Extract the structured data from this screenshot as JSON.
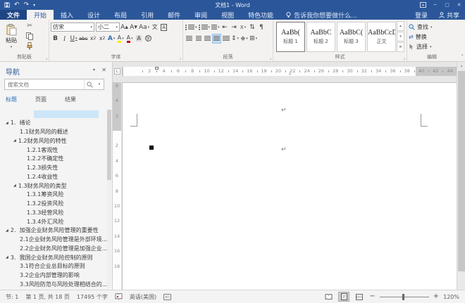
{
  "title_bar": {
    "title": "文档1 - Word",
    "signin_label": "登录",
    "share_label": "共享"
  },
  "glyphs": {
    "undo": "↶",
    "redo": "↷",
    "qat_more": "▾",
    "minimize": "─",
    "maximize": "▢",
    "close": "✕",
    "dropdown": "▾",
    "dropup": "▴",
    "more": "≣",
    "nav_close": "✕",
    "scissors": "✂",
    "grow_font": "A▴",
    "shrink_font": "A▾",
    "change_case": "Aa",
    "phonetic": "文",
    "char_border": "A",
    "bold": "B",
    "italic": "I",
    "underline": "U",
    "strikethrough": "abc",
    "subscript_base": "x",
    "subscript_mark": "2",
    "superscript_mark": "2",
    "text_effects": "A",
    "highlight": "A",
    "font_color": "A",
    "char_shading": "A",
    "enclose_char": "字",
    "outdent": "⇤",
    "indent": "⇥",
    "cjk_layout": "X",
    "sort": "⇅",
    "para_marks": "¶",
    "line_spacing": "⇕",
    "shading": "◆",
    "borders": "⊞",
    "replace_icon": "⇄",
    "expand_arrow": "◢",
    "launcher": "⌟",
    "ribbon_collapse": "˄",
    "angle": "∟",
    "center_tab": "⊥",
    "return_mark": "↵",
    "scroll_up": "▲",
    "zoom_minus": "−",
    "zoom_plus": "+"
  },
  "tabs": {
    "file": "文件",
    "items": [
      "开始",
      "插入",
      "设计",
      "布局",
      "引用",
      "邮件",
      "审阅",
      "视图",
      "特色功能"
    ],
    "selected": "开始",
    "tell_me": "告诉我你想要做什么..."
  },
  "ribbon": {
    "clipboard": {
      "label": "剪贴板",
      "paste": "粘贴"
    },
    "font": {
      "label": "字体",
      "font_name": "仿宋",
      "font_size": "小二"
    },
    "paragraph": {
      "label": "段落"
    },
    "styles": {
      "label": "样式",
      "items": [
        {
          "preview": "AaBb(",
          "name": "标题 1",
          "selected": true
        },
        {
          "preview": "AaBbC",
          "name": "标题 2",
          "selected": false
        },
        {
          "preview": "AaBbC(",
          "name": "标题 3",
          "selected": false
        },
        {
          "preview": "AaBbCcDd",
          "name": "正文",
          "selected": false
        }
      ]
    },
    "editing": {
      "label": "编辑",
      "find": "查找",
      "replace": "替换",
      "select": "选择"
    }
  },
  "nav_pane": {
    "title": "导航",
    "search_placeholder": "搜索文档",
    "tabs": [
      "标题",
      "页面",
      "结果"
    ],
    "selected_tab": "标题",
    "items": [
      {
        "blank": true,
        "selected": true,
        "level": 4,
        "text": ""
      },
      {
        "level": 1,
        "arrow": true,
        "text": "1.  绪论"
      },
      {
        "level": 2,
        "arrow": false,
        "text": "1.1财务风险的概述"
      },
      {
        "level": 2,
        "arrow": true,
        "text": "1.2财务风险的特性"
      },
      {
        "level": 3,
        "arrow": false,
        "text": "1.2.1客观性"
      },
      {
        "level": 3,
        "arrow": false,
        "text": "1.2.2不确定性"
      },
      {
        "level": 3,
        "arrow": false,
        "text": "1.2.3损失性"
      },
      {
        "level": 3,
        "arrow": false,
        "text": "1.2.4收益性"
      },
      {
        "level": 2,
        "arrow": true,
        "text": "1.3财务风险的类型"
      },
      {
        "level": 3,
        "arrow": false,
        "text": "1.3.1筹资风险"
      },
      {
        "level": 3,
        "arrow": false,
        "text": "1.3.2投资风险"
      },
      {
        "level": 3,
        "arrow": false,
        "text": "1.3.3经营风险"
      },
      {
        "level": 3,
        "arrow": false,
        "text": "1.3.4外汇风险"
      },
      {
        "level": 1,
        "arrow": true,
        "text": "2.  加强企业财务风险管理的重要性"
      },
      {
        "level": 2,
        "arrow": false,
        "text": "2.1企业财务风险管理是外部环境..."
      },
      {
        "level": 2,
        "arrow": false,
        "text": "2.2企业财务风险管理是加强企业..."
      },
      {
        "level": 1,
        "arrow": true,
        "text": "3.  我国企业财务风险控制的原则"
      },
      {
        "level": 2,
        "arrow": false,
        "text": "3.1符合企业总目标的原则"
      },
      {
        "level": 2,
        "arrow": false,
        "text": "3.2企业内部管理的影响"
      },
      {
        "level": 2,
        "arrow": false,
        "text": "3.3风险防范与风险处理相结合的..."
      }
    ]
  },
  "ruler": {
    "h_numbers": [
      2,
      4,
      6,
      8,
      10,
      12,
      14,
      16,
      18,
      20,
      22,
      24,
      26,
      28,
      30,
      32,
      34,
      36,
      38,
      40,
      42,
      44
    ],
    "v_margin_numbers": [
      6,
      4,
      2
    ],
    "v_body_numbers": [
      2,
      4,
      6,
      8,
      10,
      12,
      14,
      16,
      18
    ]
  },
  "status_bar": {
    "section": "节: 1",
    "page": "第 1 页, 共 18 页",
    "words": "17495 个字",
    "language": "英语(美国)",
    "zoom": "120%"
  }
}
